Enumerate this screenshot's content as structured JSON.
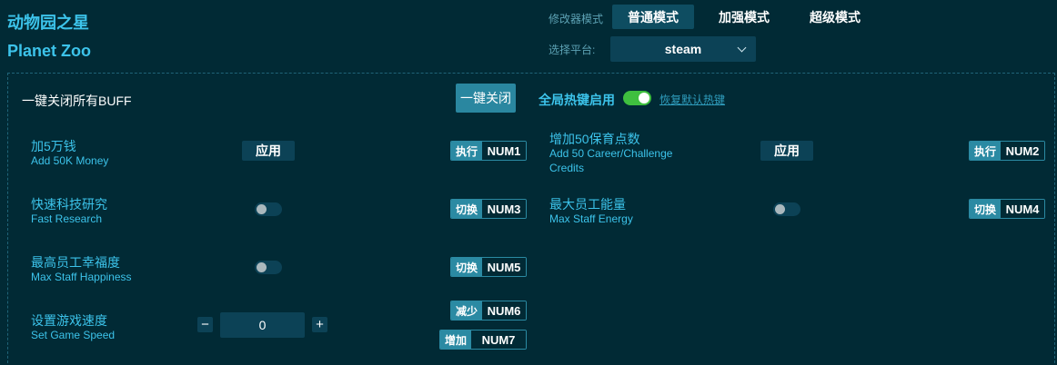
{
  "app": {
    "title_cn": "动物园之星",
    "title_en": "Planet Zoo"
  },
  "mode": {
    "label": "修改器模式",
    "buttons": [
      "普通模式",
      "加强模式",
      "超级模式"
    ],
    "active": "普通模式"
  },
  "platform": {
    "label": "选择平台:",
    "value": "steam"
  },
  "global": {
    "all_off_label": "一键关闭所有BUFF",
    "all_off_button": "一键关闭",
    "hotkey_label": "全局热键启用",
    "hotkey_enabled": true,
    "restore_link": "恢复默认热键"
  },
  "options": [
    {
      "cn": "加5万钱",
      "en": "Add 50K Money",
      "control": "应用",
      "action": "执行",
      "key": "NUM1"
    },
    {
      "cn": "增加50保育点数",
      "en": "Add 50 Career/Challenge Credits",
      "control": "应用",
      "action": "执行",
      "key": "NUM2"
    },
    {
      "cn": "快速科技研究",
      "en": "Fast Research",
      "action": "切换",
      "key": "NUM3",
      "enabled": false
    },
    {
      "cn": "最大员工能量",
      "en": "Max Staff Energy",
      "action": "切换",
      "key": "NUM4",
      "enabled": false
    },
    {
      "cn": "最高员工幸福度",
      "en": "Max Staff Happiness",
      "action": "切换",
      "key": "NUM5",
      "enabled": false
    },
    {
      "cn": "设置游戏速度",
      "en": "Set Game Speed",
      "value": "0",
      "dec_symbol": "−",
      "inc_symbol": "+",
      "dec_action": "减少",
      "dec_key": "NUM6",
      "inc_action": "增加",
      "inc_key": "NUM7"
    }
  ],
  "colors": {
    "background": "#012a35",
    "accent": "#3cc3ea",
    "toggle_on": "#3fbf3f"
  }
}
